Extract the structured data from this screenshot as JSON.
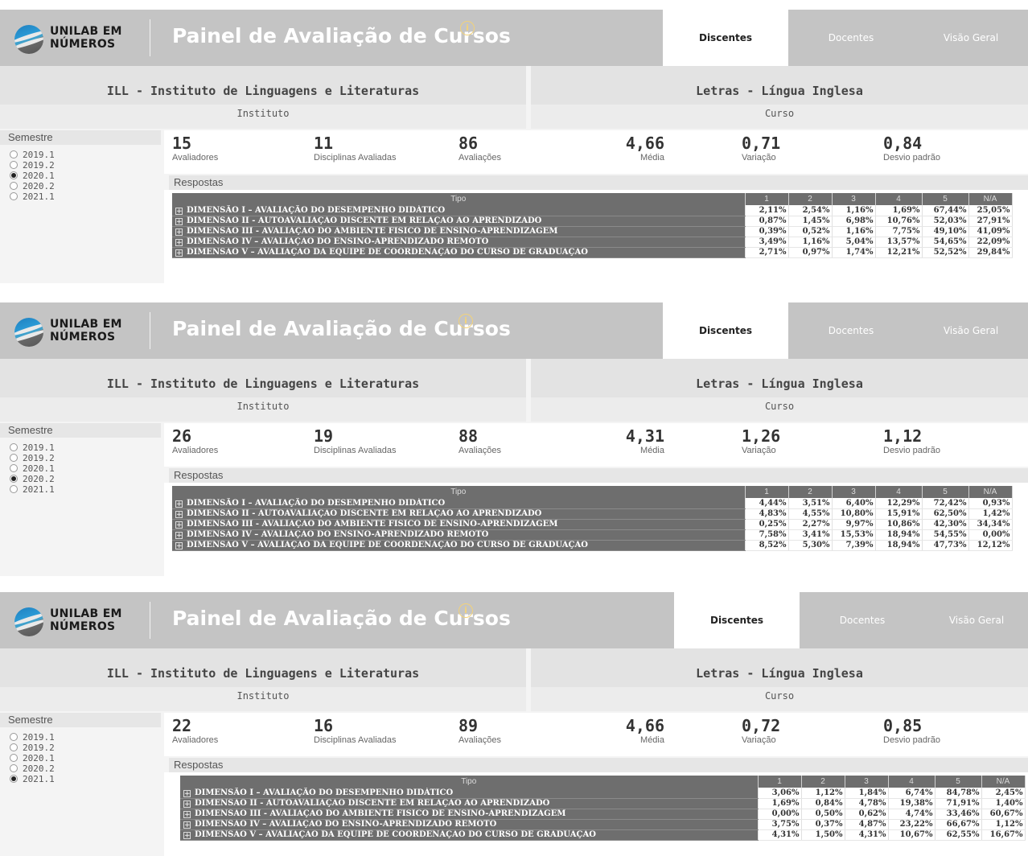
{
  "header": {
    "logo_line1": "UNILAB EM",
    "logo_line2": "NÚMEROS",
    "title": "Painel de Avaliação de Cursos",
    "info_icon": "info-circle-icon",
    "tabs": [
      "Discentes",
      "Docentes",
      "Visão Geral"
    ]
  },
  "institute": {
    "name": "ILL - Instituto de Linguagens e Literaturas",
    "label": "Instituto"
  },
  "course": {
    "name": "Letras - Língua Inglesa",
    "label": "Curso"
  },
  "semester_filter": {
    "title": "Semestre",
    "options": [
      "2019.1",
      "2019.2",
      "2020.1",
      "2020.2",
      "2021.1"
    ]
  },
  "kpi_labels": [
    "Avaliadores",
    "Disciplinas Avaliadas",
    "Avaliações",
    "Média",
    "Variação",
    "Desvio padrão"
  ],
  "respostas_title": "Respostas",
  "table_headers": [
    "Tipo",
    "1",
    "2",
    "3",
    "4",
    "5",
    "N/A"
  ],
  "dimensions": [
    "DIMENSÃO I – AVALIAÇÃO DO DESEMPENHO DIDÁTICO",
    "DIMENSÃO II - AUTOAVALIAÇÃO DISCENTE EM RELAÇÃO AO APRENDIZADO",
    "DIMENSÃO III - AVALIAÇÃO DO AMBIENTE FÍSICO DE ENSINO-APRENDIZAGEM",
    "DIMENSÃO IV – AVALIAÇÃO DO ENSINO-APRENDIZADO REMOTO",
    "DIMENSÃO V – AVALIAÇÃO DA EQUIPE DE COORDENAÇÃO DO CURSO DE GRADUAÇÃO"
  ],
  "colors": {
    "header_bg": "#c4c4c4",
    "table_dim_bg": "#6e6e6e",
    "info_icon": "#f2d27a"
  },
  "panels": [
    {
      "selected_semester": "2020.1",
      "kpis": [
        "15",
        "11",
        "86",
        "4,66",
        "0,71",
        "0,84"
      ],
      "rows": [
        [
          "2,11%",
          "2,54%",
          "1,16%",
          "1,69%",
          "67,44%",
          "25,05%"
        ],
        [
          "0,87%",
          "1,45%",
          "6,98%",
          "10,76%",
          "52,03%",
          "27,91%"
        ],
        [
          "0,39%",
          "0,52%",
          "1,16%",
          "7,75%",
          "49,10%",
          "41,09%"
        ],
        [
          "3,49%",
          "1,16%",
          "5,04%",
          "13,57%",
          "54,65%",
          "22,09%"
        ],
        [
          "2,71%",
          "0,97%",
          "1,74%",
          "12,21%",
          "52,52%",
          "29,84%"
        ]
      ]
    },
    {
      "selected_semester": "2020.2",
      "kpis": [
        "26",
        "19",
        "88",
        "4,31",
        "1,26",
        "1,12"
      ],
      "rows": [
        [
          "4,44%",
          "3,51%",
          "6,40%",
          "12,29%",
          "72,42%",
          "0,93%"
        ],
        [
          "4,83%",
          "4,55%",
          "10,80%",
          "15,91%",
          "62,50%",
          "1,42%"
        ],
        [
          "0,25%",
          "2,27%",
          "9,97%",
          "10,86%",
          "42,30%",
          "34,34%"
        ],
        [
          "7,58%",
          "3,41%",
          "15,53%",
          "18,94%",
          "54,55%",
          "0,00%"
        ],
        [
          "8,52%",
          "5,30%",
          "7,39%",
          "18,94%",
          "47,73%",
          "12,12%"
        ]
      ]
    },
    {
      "selected_semester": "2021.1",
      "kpis": [
        "22",
        "16",
        "89",
        "4,66",
        "0,72",
        "0,85"
      ],
      "rows": [
        [
          "3,06%",
          "1,12%",
          "1,84%",
          "6,74%",
          "84,78%",
          "2,45%"
        ],
        [
          "1,69%",
          "0,84%",
          "4,78%",
          "19,38%",
          "71,91%",
          "1,40%"
        ],
        [
          "0,00%",
          "0,50%",
          "0,62%",
          "4,74%",
          "33,46%",
          "60,67%"
        ],
        [
          "3,75%",
          "0,37%",
          "4,87%",
          "23,22%",
          "66,67%",
          "1,12%"
        ],
        [
          "4,31%",
          "1,50%",
          "4,31%",
          "10,67%",
          "62,55%",
          "16,67%"
        ]
      ]
    }
  ]
}
